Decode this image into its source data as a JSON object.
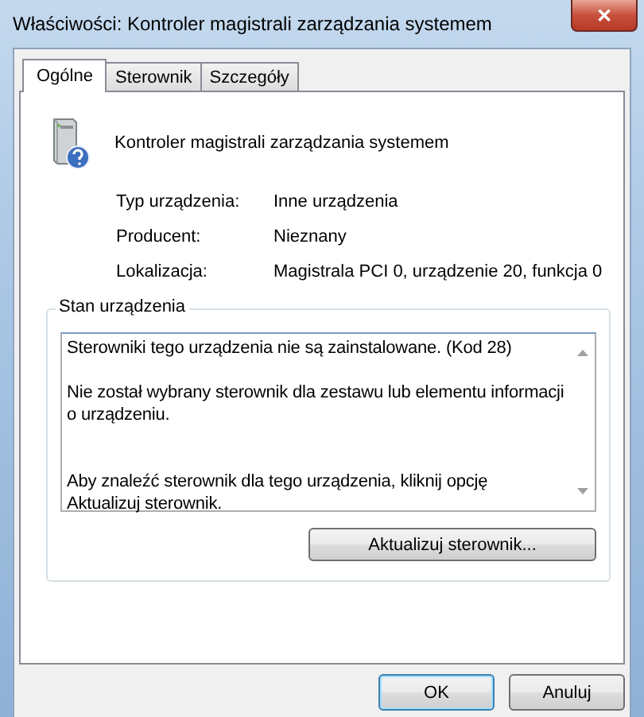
{
  "window": {
    "title": "Właściwości: Kontroler magistrali zarządzania systemem",
    "close": "✕"
  },
  "tabs": [
    {
      "label": "Ogólne",
      "selected": true
    },
    {
      "label": "Sterownik",
      "selected": false
    },
    {
      "label": "Szczegóły",
      "selected": false
    }
  ],
  "device_name": "Kontroler magistrali zarządzania systemem",
  "properties": [
    {
      "label": "Typ urządzenia:",
      "value": "Inne urządzenia"
    },
    {
      "label": "Producent:",
      "value": "Nieznany"
    },
    {
      "label": "Lokalizacja:",
      "value": "Magistrala PCI 0, urządzenie 20, funkcja 0"
    }
  ],
  "status_group": {
    "title": "Stan urządzenia",
    "paragraphs": [
      {
        "text": "Sterowniki tego urządzenia nie są zainstalowane. (Kod 28)",
        "extra_space_before": false
      },
      {
        "text": "Nie został wybrany sterownik dla zestawu lub elementu informacji o urządzeniu.",
        "extra_space_before": false
      },
      {
        "text": "Aby znaleźć sterownik dla tego urządzenia, kliknij opcję Aktualizuj sterownik.",
        "extra_space_before": true
      }
    ],
    "button": "Aktualizuj sterownik..."
  },
  "buttons": [
    {
      "label": "OK",
      "default": true
    },
    {
      "label": "Anuluj",
      "default": false
    }
  ]
}
